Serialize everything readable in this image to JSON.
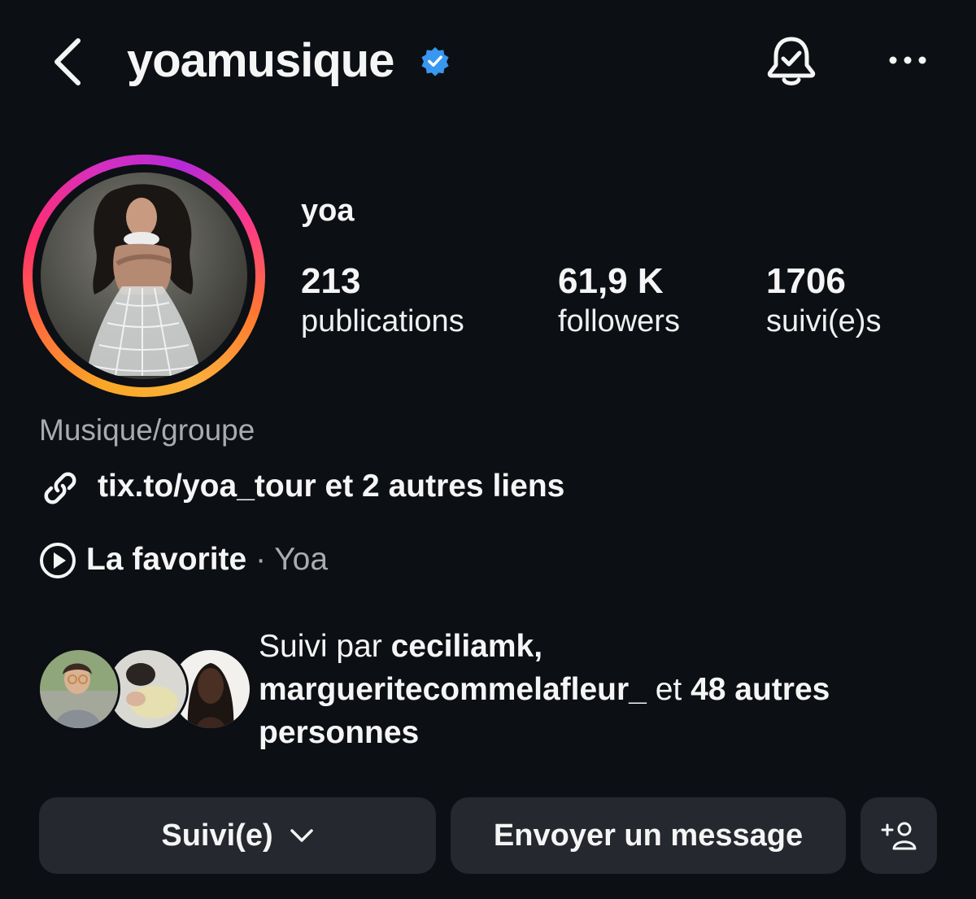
{
  "header": {
    "username": "yoamusique",
    "verified": true,
    "icons": [
      "back-chevron-icon",
      "verified-badge-icon",
      "notification-bell-icon",
      "more-options-icon"
    ]
  },
  "profile": {
    "display_name": "yoa",
    "stats": [
      {
        "value": "213",
        "label": "publications"
      },
      {
        "value": "61,9 K",
        "label": "followers"
      },
      {
        "value": "1706",
        "label": "suivi(e)s"
      }
    ],
    "category": "Musique/groupe",
    "link_text": "tix.to/yoa_tour et 2 autres liens",
    "song": {
      "title": "La favorite",
      "separator": " · ",
      "artist": "Yoa"
    }
  },
  "followed_by": {
    "prefix": "Suivi par ",
    "user1": "ceciliamk",
    "comma": ",",
    "user2": "margueritecommelafleur_",
    "middle": " et ",
    "count_text": "48 autres personnes"
  },
  "actions": {
    "follow_label": "Suivi(e)",
    "message_label": "Envoyer un message"
  },
  "colors": {
    "background": "#0c0f14",
    "button": "#25282e",
    "verified": "#3897f0",
    "muted_text": "#a8abb0"
  }
}
